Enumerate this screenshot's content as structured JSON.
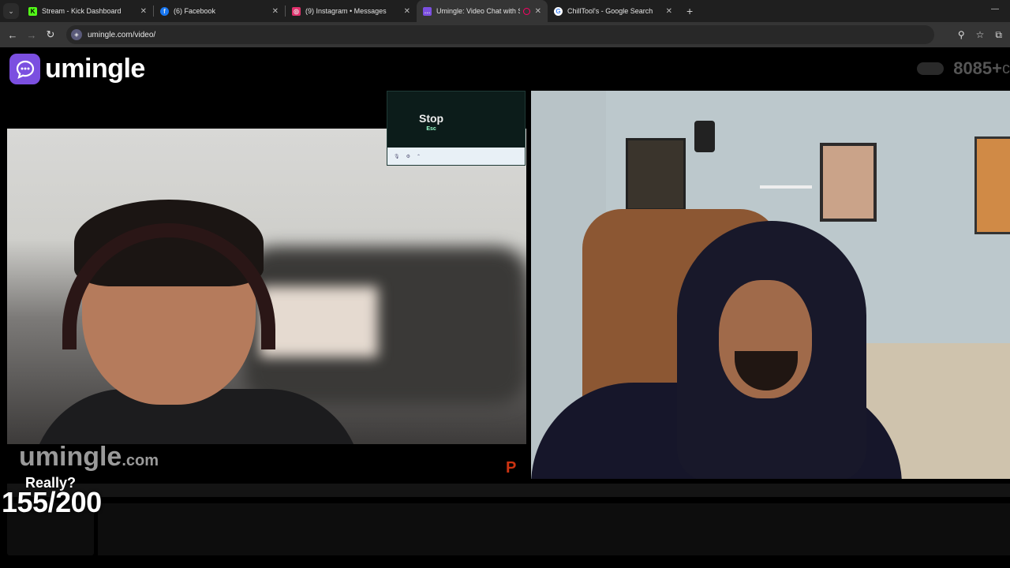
{
  "browser": {
    "tabs": [
      {
        "title": "Stream - Kick Dashboard",
        "favicon": "kick-icon",
        "color": "#53fc18",
        "active": false
      },
      {
        "title": "(6) Facebook",
        "favicon": "facebook-icon",
        "color": "#1877f2",
        "active": false
      },
      {
        "title": "(9) Instagram • Messages",
        "favicon": "instagram-icon",
        "color": "#e1306c",
        "active": false
      },
      {
        "title": "Umingle: Video Chat with S",
        "favicon": "umingle-icon",
        "color": "#7b4fe0",
        "active": true
      },
      {
        "title": "ChillTool's - Google Search",
        "favicon": "google-icon",
        "color": "#ffffff",
        "active": false
      }
    ],
    "url": "umingle.com/video/"
  },
  "site": {
    "name": "umingle",
    "online_count": "8085+",
    "online_suffix": "c",
    "watermark_main": "umingle",
    "watermark_suffix": ".com"
  },
  "screen_share": {
    "stop_label": "Stop",
    "stop_hint": "Esc"
  },
  "overlay": {
    "caption": "Really?",
    "counter": "155/200"
  },
  "colors": {
    "brand": "#7b4fe0",
    "background": "#000000"
  }
}
